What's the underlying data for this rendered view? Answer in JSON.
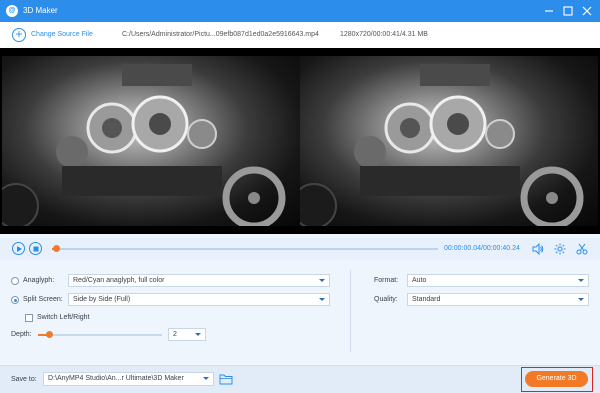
{
  "window": {
    "title": "3D Maker",
    "app_icon_letter": "@"
  },
  "source": {
    "change_label": "Change Source File",
    "file_path": "C:/Users/Administrator/Pictu...09efb087d1ed0a2e5916643.mp4",
    "file_meta": "1280x720/00:00:41/4.31 MB"
  },
  "player": {
    "current_time": "00:00:00.04",
    "separator": "/",
    "total_time": "00:00:40.24",
    "progress_fraction": 0.005
  },
  "settings": {
    "anaglyph": {
      "label": "Anaglyph:",
      "value": "Red/Cyan anaglyph, full color",
      "selected": false
    },
    "split_screen": {
      "label": "Split Screen:",
      "value": "Side by Side (Full)",
      "selected": true
    },
    "switch_lr": {
      "label": "Switch Left/Right",
      "checked": false
    },
    "depth": {
      "label": "Depth:",
      "value": "2",
      "slider_fraction": 0.08
    },
    "format": {
      "label": "Format:",
      "value": "Auto"
    },
    "quality": {
      "label": "Quality:",
      "value": "Standard"
    }
  },
  "output": {
    "save_to_label": "Save to:",
    "save_path": "D:\\AnyMP4 Studio\\An...r Ultimate\\3D Maker",
    "generate_label": "Generate 3D"
  },
  "colors": {
    "accent": "#2c8eea",
    "orange": "#f27a27",
    "highlight": "#d9251d"
  },
  "icons": [
    "plus-circle-icon",
    "play-icon",
    "stop-icon",
    "volume-icon",
    "settings-icon",
    "scissors-icon",
    "folder-icon",
    "dropdown-caret-icon"
  ]
}
